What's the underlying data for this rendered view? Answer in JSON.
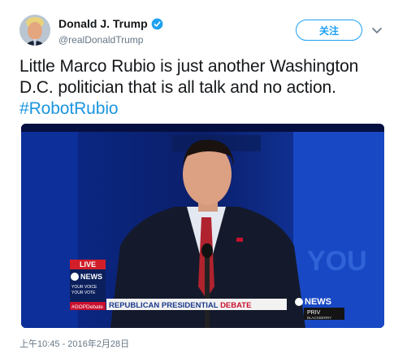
{
  "header": {
    "display_name": "Donald J. Trump",
    "handle": "@realDonaldTrump",
    "follow_label": "关注"
  },
  "tweet": {
    "text_line1": "Little Marco Rubio is just another Washington",
    "text_line2": "D.C. politician that is all talk and no action.",
    "hashtag": "#RobotRubio",
    "timestamp": "上午10:45 - 2016年2月28日"
  },
  "video_overlay": {
    "live": "LIVE",
    "news_logo": "NEWS",
    "your_voice": "YOUR VOICE",
    "your_vote": "YOUR VOTE",
    "hashtag": "#GOPDebate",
    "banner_prefix": "REPUBLICAN PRESIDENTIAL ",
    "banner_emph": "DEBATE",
    "corner_news": "NEWS",
    "priv": "PRIV",
    "blackberry": "BLACKBERRY",
    "bg_text": "YOU"
  },
  "colors": {
    "accent": "#1da1f2",
    "hashtag": "#1b95e0",
    "muted": "#657786",
    "debate_red": "#c8102e"
  }
}
